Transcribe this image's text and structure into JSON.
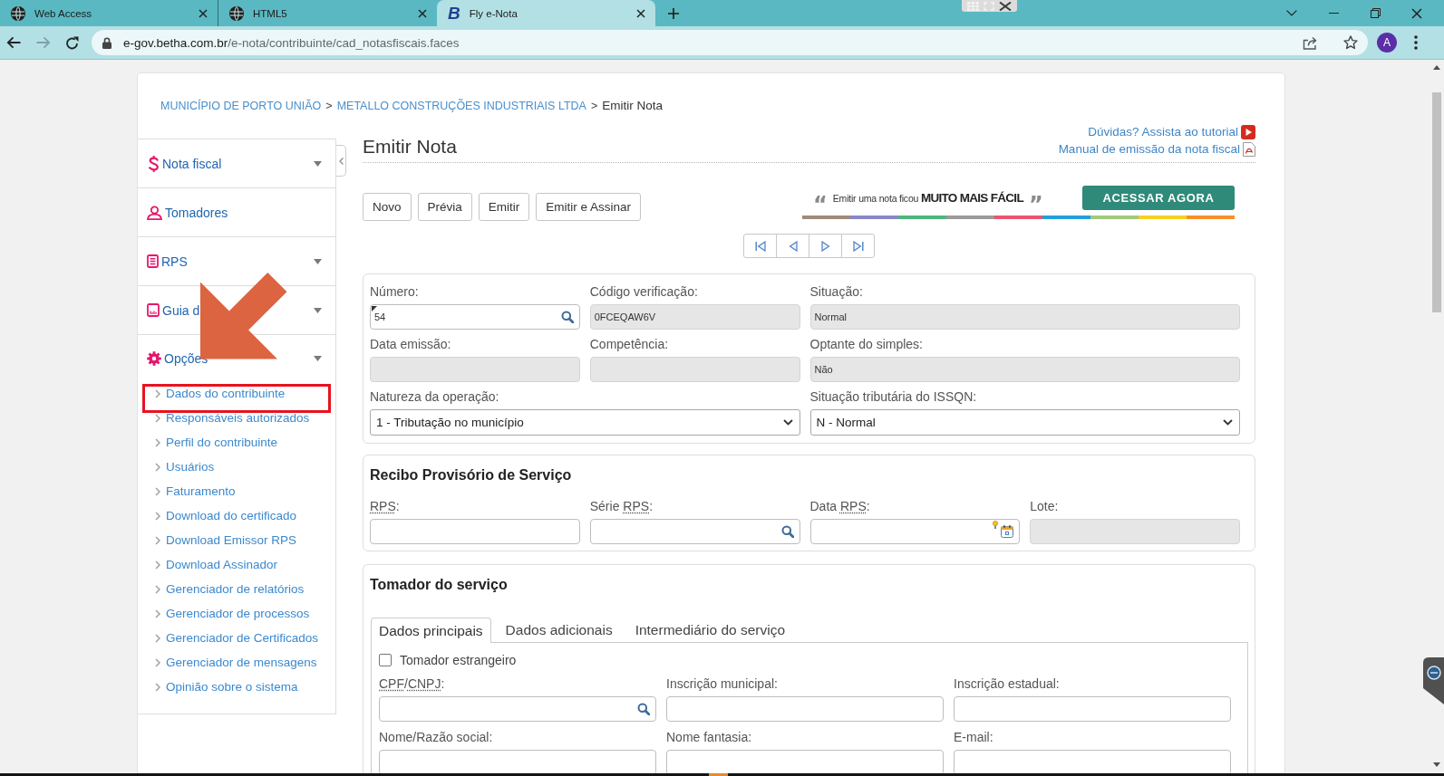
{
  "browser": {
    "tabs": [
      {
        "title": "Web Access",
        "selected": false
      },
      {
        "title": "HTML5",
        "selected": false
      },
      {
        "title": "Fly e-Nota",
        "selected": true,
        "logo": "B"
      }
    ],
    "url_host": "e-gov.betha.com.br",
    "url_path": "/e-nota/contribuinte/cad_notasfiscais.faces",
    "forward_disabled": true,
    "profile_initial": "A"
  },
  "breadcrumb": [
    {
      "kind": "link",
      "text": "MUNICÍPIO DE PORTO UNIÃO"
    },
    {
      "kind": "separator",
      "text": ">"
    },
    {
      "kind": "link",
      "text": "METALLO CONSTRUÇÕES INDUSTRIAIS LTDA"
    },
    {
      "kind": "separator",
      "text": ">"
    },
    {
      "kind": "current",
      "text": "Emitir Nota"
    }
  ],
  "sidebar": {
    "sections": [
      {
        "label": "Nota fiscal",
        "kind": "menu"
      },
      {
        "label": "Tomadores",
        "kind": "link"
      },
      {
        "label": "RPS",
        "kind": "menu"
      },
      {
        "label": "Guia d",
        "kind": "menu"
      },
      {
        "label": "Opções",
        "kind": "menu",
        "children": [
          {
            "label": "Dados do contribuinte",
            "highlighted": true
          },
          {
            "label": "Responsáveis autorizados",
            "highlighted": false
          },
          {
            "label": "Perfil do contribuinte",
            "highlighted": false
          },
          {
            "label": "Usuários",
            "highlighted": false
          },
          {
            "label": "Faturamento",
            "highlighted": false
          },
          {
            "label": "Download do certificado",
            "highlighted": false
          },
          {
            "label": "Download Emissor RPS",
            "highlighted": false
          },
          {
            "label": "Download Assinador",
            "highlighted": false
          },
          {
            "label": "Gerenciador de relatórios",
            "highlighted": false
          },
          {
            "label": "Gerenciador de processos",
            "highlighted": false
          },
          {
            "label": "Gerenciador de Certificados",
            "highlighted": false
          },
          {
            "label": "Gerenciador de mensagens",
            "highlighted": false
          },
          {
            "label": "Opinião sobre o sistema",
            "highlighted": false
          }
        ]
      }
    ]
  },
  "header": {
    "title": "Emitir Nota",
    "help_links": [
      {
        "text": "Dúvidas? Assista ao tutorial",
        "kind": "video"
      },
      {
        "text": "Manual de emissão da nota fiscal",
        "kind": "pdf"
      }
    ]
  },
  "actions": [
    "Novo",
    "Prévia",
    "Emitir",
    "Emitir e Assinar"
  ],
  "promo": {
    "open_quote": "“",
    "text": "Emitir uma nota ficou **MUITO MAIS FÁCIL**",
    "close_quote": "”",
    "button": "ACESSAR AGORA"
  },
  "nota_panel": {
    "rows": [
      [
        {
          "label": "Número:",
          "kind": "lookup",
          "value": "54",
          "readonly": false,
          "marked": true
        },
        {
          "label": "Código verificação:",
          "kind": "input",
          "value": "0FCEQAW6V",
          "readonly": true
        },
        {
          "label": "Situação:",
          "kind": "input",
          "value": "Normal",
          "readonly": true
        }
      ],
      [
        {
          "label": "Data emissão:",
          "kind": "input",
          "readonly": true
        },
        {
          "label": "Competência:",
          "kind": "input",
          "readonly": true
        },
        {
          "label": "Optante do simples:",
          "kind": "input",
          "value": "Não",
          "readonly": true
        }
      ]
    ],
    "dropdowns": [
      {
        "label": "Natureza da operação:",
        "kind": "select",
        "value": "1 - Tributação no município"
      },
      {
        "label": "Situação tributária do ISSQN:",
        "kind": "select",
        "value": "N - Normal"
      }
    ]
  },
  "rps_panel": {
    "title": "Recibo Provisório de Serviço",
    "rows": [
      [
        {
          "label_parts": [
            {
              "text": "RPS",
              "abbr": true
            },
            {
              "text": ":"
            }
          ],
          "kind": "input",
          "readonly": false
        },
        {
          "label_parts": [
            {
              "text": "Série "
            },
            {
              "text": "RPS",
              "abbr": true
            },
            {
              "text": ":"
            }
          ],
          "kind": "lookup",
          "readonly": false
        },
        {
          "label_parts": [
            {
              "text": "Data "
            },
            {
              "text": "RPS",
              "abbr": true
            },
            {
              "text": ":"
            }
          ],
          "kind": "date",
          "readonly": false
        },
        {
          "label": "Lote:",
          "kind": "input",
          "readonly": true
        }
      ]
    ]
  },
  "tomador_panel": {
    "title": "Tomador do serviço",
    "tabs": [
      {
        "label": "Dados principais",
        "selected": true
      },
      {
        "label": "Dados adicionais",
        "selected": false
      },
      {
        "label": "Intermediário do serviço",
        "selected": false
      }
    ],
    "checkbox": {
      "label": "Tomador estrangeiro",
      "checked": false
    },
    "rows": [
      [
        {
          "label_parts": [
            {
              "text": "CPF",
              "abbr": true
            },
            {
              "text": "/"
            },
            {
              "text": "CNPJ",
              "abbr": true
            },
            {
              "text": ":"
            }
          ],
          "kind": "lookup",
          "readonly": false
        },
        {
          "label": "Inscrição municipal:",
          "kind": "input",
          "readonly": false
        },
        {
          "label": "Inscrição estadual:",
          "kind": "input",
          "readonly": false
        }
      ],
      [
        {
          "label": "Nome/Razão social:",
          "kind": "input",
          "readonly": false
        },
        {
          "label": "Nome fantasia:",
          "kind": "input",
          "readonly": false
        },
        {
          "label": "E-mail:",
          "kind": "input",
          "readonly": false
        }
      ]
    ]
  }
}
